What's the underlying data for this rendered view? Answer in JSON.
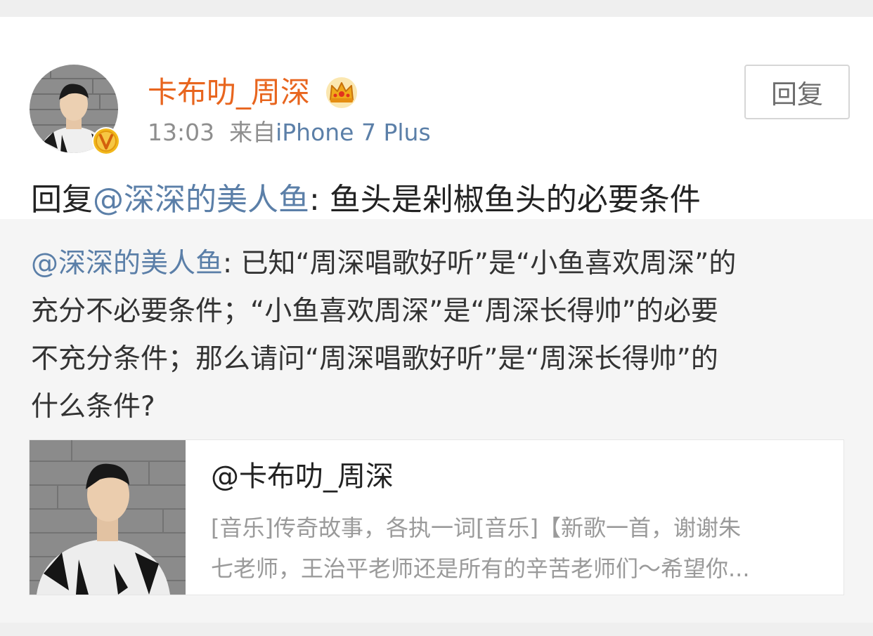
{
  "post": {
    "username": "卡布叻_周深",
    "time": "13:03",
    "source_prefix": "来自",
    "source_device": "iPhone 7 Plus",
    "reply_button": "回复",
    "reply_prefix": "回复",
    "reply_mention": "@深深的美人鱼",
    "reply_body": ": 鱼头是剁椒鱼头的必要条件"
  },
  "quoted": {
    "mention": "@深深的美人鱼",
    "line1_rest": ": 已知“周深唱歌好听”是“小鱼喜欢周深”的",
    "line2": "充分不必要条件；“小鱼喜欢周深”是“周深长得帅”的必要",
    "line3": "不充分条件；那么请问“周深唱歌好听”是“周深长得帅”的",
    "line4": "什么条件?"
  },
  "share_card": {
    "title": "@卡布叻_周深",
    "desc_line1": "[音乐]传奇故事，各执一词[音乐]【新歌一首，谢谢朱",
    "desc_line2": "七老师，王治平老师还是所有的辛苦老师们～希望你..."
  },
  "icons": {
    "avatar": "user-avatar",
    "verified_badge": "verified-v-icon",
    "member_badge": "crown-icon"
  },
  "colors": {
    "username": "#e8651e",
    "link": "#5b7fa8",
    "quote_background": "#f5f5f5"
  }
}
